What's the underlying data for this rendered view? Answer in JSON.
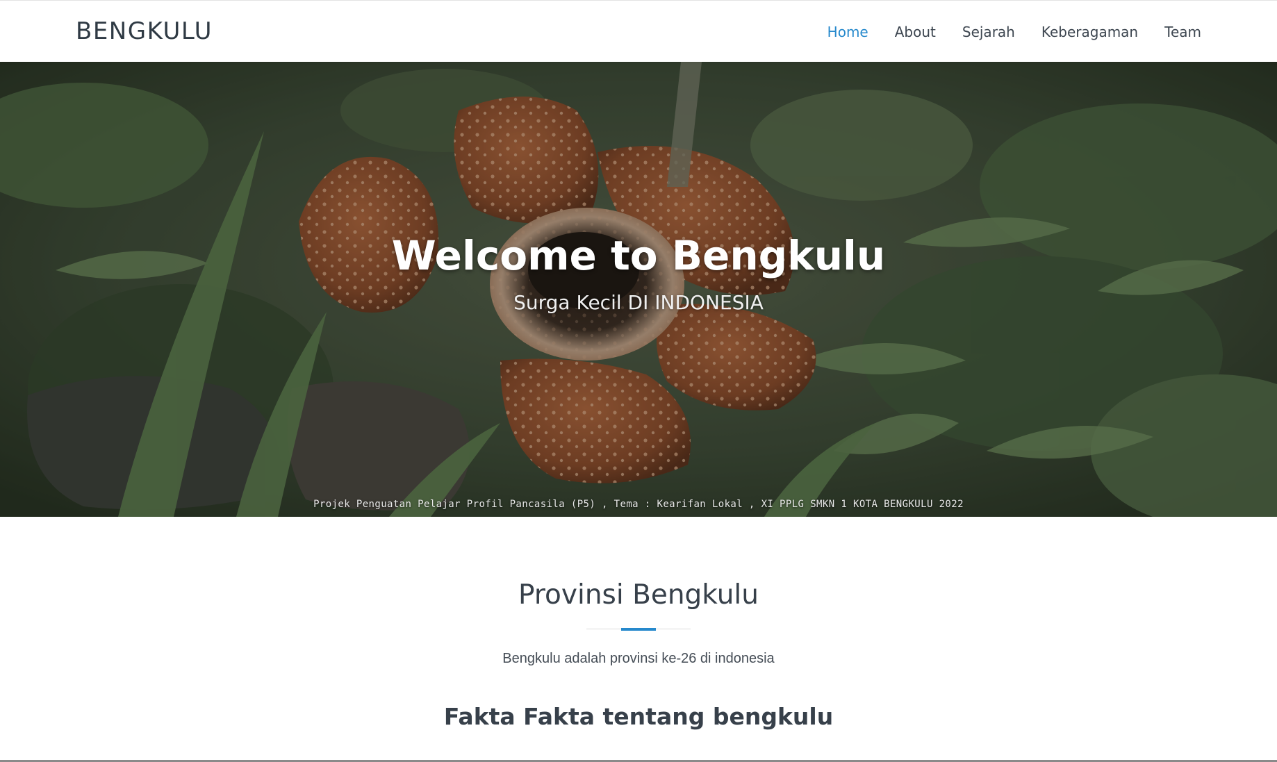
{
  "navbar": {
    "brand": "BENGKULU",
    "links": [
      {
        "label": "Home",
        "active": true
      },
      {
        "label": "About",
        "active": false
      },
      {
        "label": "Sejarah",
        "active": false
      },
      {
        "label": "Keberagaman",
        "active": false
      },
      {
        "label": "Team",
        "active": false
      }
    ]
  },
  "hero": {
    "title": "Welcome to Bengkulu",
    "subtitle": "Surga Kecil DI INDONESIA",
    "credit": "Projek Penguatan Pelajar Profil Pancasila (P5) , Tema : Kearifan Lokal , XI PPLG SMKN 1 KOTA BENGKULU 2022",
    "background_image": "rafflesia-flower-in-forest"
  },
  "section": {
    "title": "Provinsi Bengkulu",
    "description": "Bengkulu adalah provinsi ke-26 di indonesia",
    "facts_title": "Fakta Fakta tentang bengkulu"
  },
  "colors": {
    "accent": "#2689cc",
    "text": "#37404a"
  }
}
